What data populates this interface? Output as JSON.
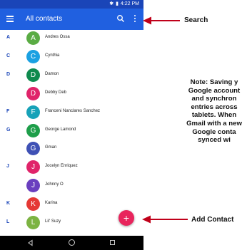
{
  "status_bar": {
    "time": "4:22 PM"
  },
  "app_bar": {
    "title": "All contacts"
  },
  "contacts": [
    {
      "letter": "A",
      "initial": "A",
      "name": "Andres Ossa",
      "color": "#5aac44"
    },
    {
      "letter": "C",
      "initial": "C",
      "name": "Cynthia",
      "color": "#1ba1e2"
    },
    {
      "letter": "D",
      "initial": "D",
      "name": "Damon",
      "color": "#0f8a4e"
    },
    {
      "letter": "",
      "initial": "D",
      "name": "Debby Deb",
      "color": "#e0246a"
    },
    {
      "letter": "F",
      "initial": "F",
      "name": "Franceni Nanclares Sanchez",
      "color": "#17a2b8"
    },
    {
      "letter": "G",
      "initial": "G",
      "name": "George Lamond",
      "color": "#1e9e4a"
    },
    {
      "letter": "",
      "initial": "G",
      "name": "Gman",
      "color": "#3f51b5"
    },
    {
      "letter": "J",
      "initial": "J",
      "name": "Jocelyn Enriquez",
      "color": "#e0246a"
    },
    {
      "letter": "",
      "initial": "J",
      "name": "Johnny O",
      "color": "#6a3fbf"
    },
    {
      "letter": "K",
      "initial": "K",
      "name": "Karina",
      "color": "#e53935"
    },
    {
      "letter": "L",
      "initial": "L",
      "name": "Lil' Suzy",
      "color": "#7cb342"
    }
  ],
  "fab": {
    "symbol": "+",
    "color": "#e8245c"
  },
  "annotations": {
    "search_label": "Search",
    "add_contact_label": "Add Contact",
    "note_lines": [
      "Note: Saving y",
      "Google account",
      "and synchron",
      "entries across",
      "tablets. When",
      "Gmail with a new",
      "Google conta",
      "synced wi"
    ]
  },
  "icons": {
    "menu": "menu-icon",
    "search": "search-icon",
    "more": "more-vert-icon",
    "back": "back-icon",
    "home": "home-icon",
    "recent": "recent-apps-icon"
  }
}
